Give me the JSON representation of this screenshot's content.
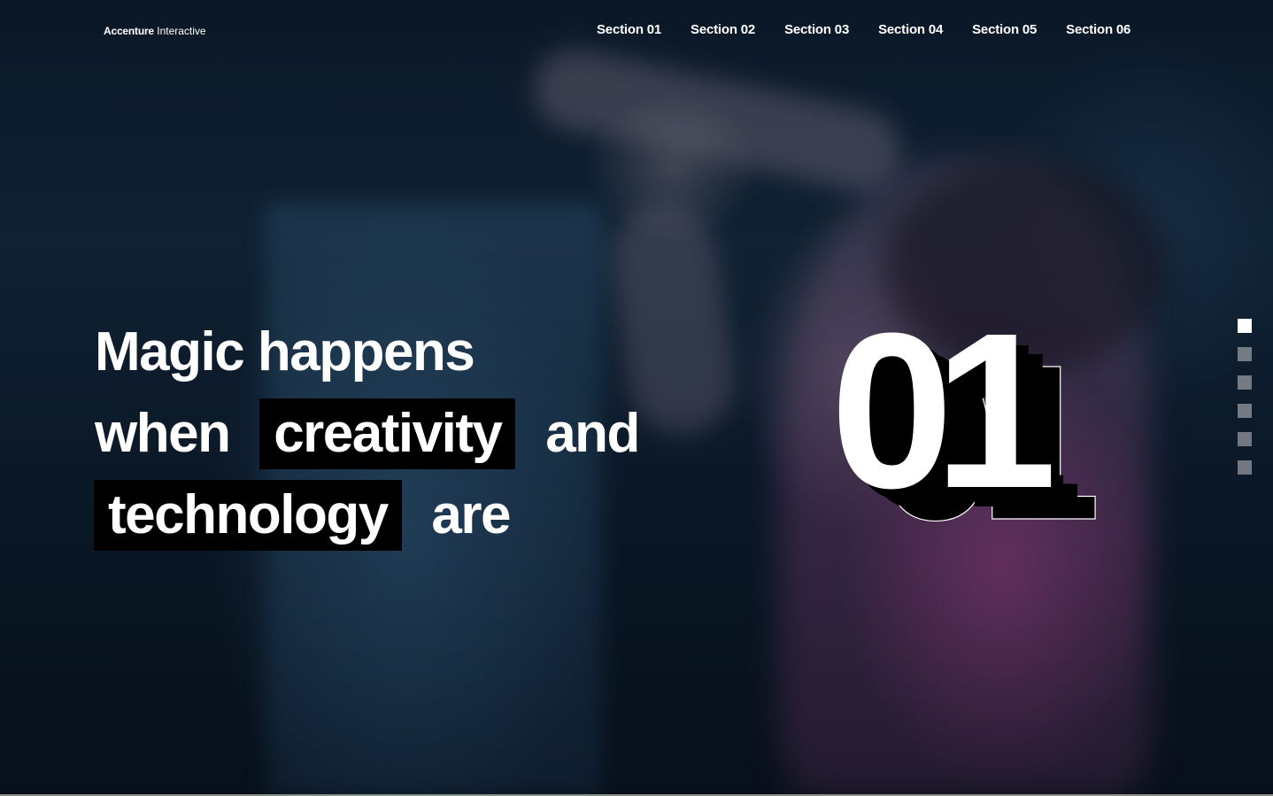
{
  "header": {
    "logo_brand": "Accenture",
    "logo_sub": "Interactive",
    "nav": [
      "Section 01",
      "Section 02",
      "Section 03",
      "Section 04",
      "Section 05",
      "Section 06"
    ]
  },
  "hero": {
    "line1": "Magic happens",
    "line2_pre": "when",
    "line2_hl": "creativity",
    "line2_post": "and",
    "line3_hl": "technology",
    "line3_post": "are",
    "section_number": "01"
  },
  "pager": {
    "count": 6,
    "active_index": 0
  },
  "colors": {
    "text": "#ffffff",
    "highlight_bg": "#000000",
    "pager_inactive": "#9a9a9a"
  }
}
